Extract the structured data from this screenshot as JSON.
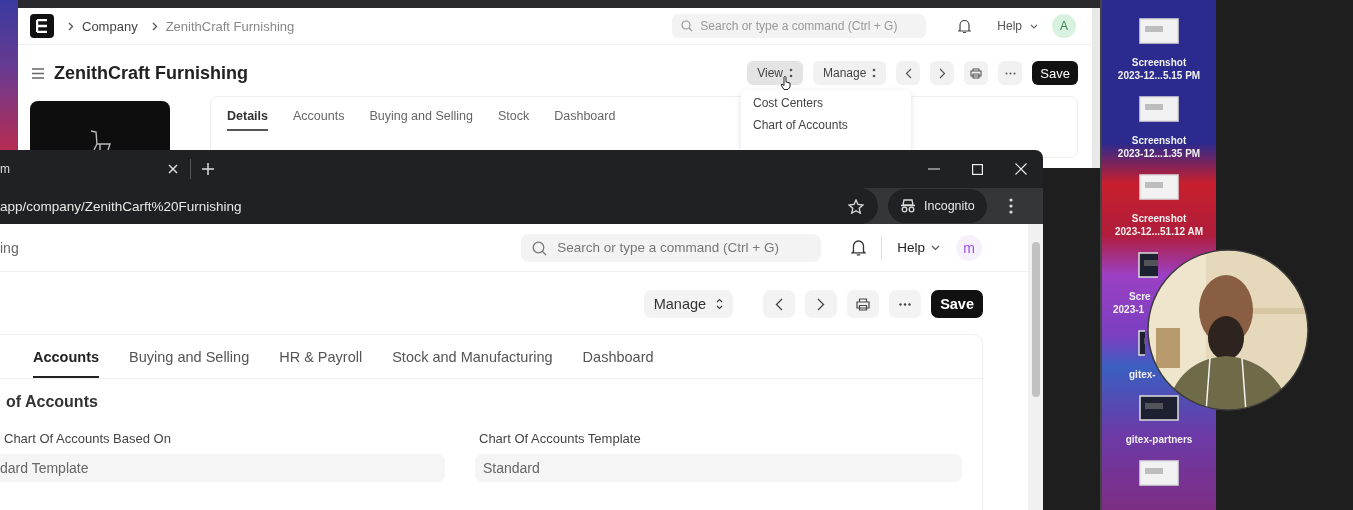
{
  "back_window": {
    "breadcrumbs": [
      "Company",
      "ZenithCraft Furnishing"
    ],
    "search": {
      "placeholder": "Search or type a command (Ctrl + G)"
    },
    "help": "Help",
    "avatar": "A",
    "title": "ZenithCraft Furnishing",
    "actions": {
      "view": "View",
      "manage": "Manage",
      "save": "Save"
    },
    "view_menu": [
      {
        "label": "Cost Centers"
      },
      {
        "label": "Chart of Accounts"
      }
    ],
    "tabs": [
      {
        "label": "Details",
        "selected": true
      },
      {
        "label": "Accounts",
        "selected": false
      },
      {
        "label": "Buying and Selling",
        "selected": false
      },
      {
        "label": "Stock",
        "selected": false
      },
      {
        "label": "Dashboard",
        "selected": false
      }
    ]
  },
  "browser": {
    "tab_title": "m",
    "url": "app/company/ZenithCarft%20Furnishing",
    "incognito": "Incognito",
    "page": {
      "breadcrumb": "ing",
      "search": {
        "placeholder": "Search or type a command (Ctrl + G)"
      },
      "help": "Help",
      "avatar": "m",
      "actions": {
        "manage": "Manage",
        "save": "Save"
      },
      "tabs": [
        {
          "label": "Accounts",
          "selected": true
        },
        {
          "label": "Buying and Selling",
          "selected": false
        },
        {
          "label": "HR & Payroll",
          "selected": false
        },
        {
          "label": "Stock and Manufacturing",
          "selected": false
        },
        {
          "label": "Dashboard",
          "selected": false
        }
      ],
      "section_title": "of Accounts",
      "fields": [
        {
          "label": "Chart Of Accounts Based On",
          "value": "dard Template"
        },
        {
          "label": "Chart Of Accounts Template",
          "value": "Standard"
        }
      ]
    }
  },
  "desktop": {
    "files": [
      {
        "kind": "light",
        "name": [
          "Screenshot",
          "2023-12...5.15 PM"
        ]
      },
      {
        "kind": "light",
        "name": [
          "Screenshot",
          "2023-12...1.35 PM"
        ]
      },
      {
        "kind": "light",
        "name": [
          "Screenshot",
          "2023-12...51.12 AM"
        ]
      },
      {
        "kind": "dark",
        "name": [
          "Scre",
          "2023-1"
        ]
      },
      {
        "kind": "dark",
        "name": [
          "gitex-"
        ]
      },
      {
        "kind": "dark",
        "name": [
          "gitex-partners"
        ]
      },
      {
        "kind": "light"
      }
    ]
  }
}
